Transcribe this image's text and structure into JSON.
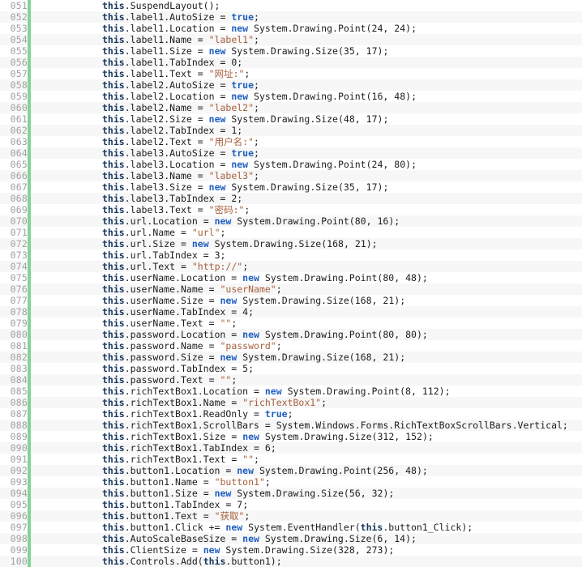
{
  "editor": {
    "name": "code-editor",
    "language": "csharp",
    "first_line_number": 51,
    "last_line_number": 100,
    "colors": {
      "background": "#ffffff",
      "stripe": "#f7f7f7",
      "gutter_text": "#a0a0a0",
      "change_bar": "#7fd695",
      "keyword": "#1f5fbf",
      "this_keyword": "#17365d",
      "string": "#a6603d",
      "plain": "#1c1c1c"
    },
    "indent": "            "
  },
  "lines": [
    {
      "num": "051",
      "text": "this.SuspendLayout();"
    },
    {
      "num": "052",
      "text": "this.label1.AutoSize = true;"
    },
    {
      "num": "053",
      "text": "this.label1.Location = new System.Drawing.Point(24, 24);"
    },
    {
      "num": "054",
      "text": "this.label1.Name = \"label1\";"
    },
    {
      "num": "055",
      "text": "this.label1.Size = new System.Drawing.Size(35, 17);"
    },
    {
      "num": "056",
      "text": "this.label1.TabIndex = 0;"
    },
    {
      "num": "057",
      "text": "this.label1.Text = \"网址:\";"
    },
    {
      "num": "058",
      "text": "this.label2.AutoSize = true;"
    },
    {
      "num": "059",
      "text": "this.label2.Location = new System.Drawing.Point(16, 48);"
    },
    {
      "num": "060",
      "text": "this.label2.Name = \"label2\";"
    },
    {
      "num": "061",
      "text": "this.label2.Size = new System.Drawing.Size(48, 17);"
    },
    {
      "num": "062",
      "text": "this.label2.TabIndex = 1;"
    },
    {
      "num": "063",
      "text": "this.label2.Text = \"用户名:\";"
    },
    {
      "num": "064",
      "text": "this.label3.AutoSize = true;"
    },
    {
      "num": "065",
      "text": "this.label3.Location = new System.Drawing.Point(24, 80);"
    },
    {
      "num": "066",
      "text": "this.label3.Name = \"label3\";"
    },
    {
      "num": "067",
      "text": "this.label3.Size = new System.Drawing.Size(35, 17);"
    },
    {
      "num": "068",
      "text": "this.label3.TabIndex = 2;"
    },
    {
      "num": "069",
      "text": "this.label3.Text = \"密码:\";"
    },
    {
      "num": "070",
      "text": "this.url.Location = new System.Drawing.Point(80, 16);"
    },
    {
      "num": "071",
      "text": "this.url.Name = \"url\";"
    },
    {
      "num": "072",
      "text": "this.url.Size = new System.Drawing.Size(168, 21);"
    },
    {
      "num": "073",
      "text": "this.url.TabIndex = 3;"
    },
    {
      "num": "074",
      "text": "this.url.Text = \"http://\";"
    },
    {
      "num": "075",
      "text": "this.userName.Location = new System.Drawing.Point(80, 48);"
    },
    {
      "num": "076",
      "text": "this.userName.Name = \"userName\";"
    },
    {
      "num": "077",
      "text": "this.userName.Size = new System.Drawing.Size(168, 21);"
    },
    {
      "num": "078",
      "text": "this.userName.TabIndex = 4;"
    },
    {
      "num": "079",
      "text": "this.userName.Text = \"\";"
    },
    {
      "num": "080",
      "text": "this.password.Location = new System.Drawing.Point(80, 80);"
    },
    {
      "num": "081",
      "text": "this.password.Name = \"password\";"
    },
    {
      "num": "082",
      "text": "this.password.Size = new System.Drawing.Size(168, 21);"
    },
    {
      "num": "083",
      "text": "this.password.TabIndex = 5;"
    },
    {
      "num": "084",
      "text": "this.password.Text = \"\";"
    },
    {
      "num": "085",
      "text": "this.richTextBox1.Location = new System.Drawing.Point(8, 112);"
    },
    {
      "num": "086",
      "text": "this.richTextBox1.Name = \"richTextBox1\";"
    },
    {
      "num": "087",
      "text": "this.richTextBox1.ReadOnly = true;"
    },
    {
      "num": "088",
      "text": "this.richTextBox1.ScrollBars = System.Windows.Forms.RichTextBoxScrollBars.Vertical;"
    },
    {
      "num": "089",
      "text": "this.richTextBox1.Size = new System.Drawing.Size(312, 152);"
    },
    {
      "num": "090",
      "text": "this.richTextBox1.TabIndex = 6;"
    },
    {
      "num": "091",
      "text": "this.richTextBox1.Text = \"\";"
    },
    {
      "num": "092",
      "text": "this.button1.Location = new System.Drawing.Point(256, 48);"
    },
    {
      "num": "093",
      "text": "this.button1.Name = \"button1\";"
    },
    {
      "num": "094",
      "text": "this.button1.Size = new System.Drawing.Size(56, 32);"
    },
    {
      "num": "095",
      "text": "this.button1.TabIndex = 7;"
    },
    {
      "num": "096",
      "text": "this.button1.Text = \"获取\";"
    },
    {
      "num": "097",
      "text": "this.button1.Click += new System.EventHandler(this.button1_Click);"
    },
    {
      "num": "098",
      "text": "this.AutoScaleBaseSize = new System.Drawing.Size(6, 14);"
    },
    {
      "num": "099",
      "text": "this.ClientSize = new System.Drawing.Size(328, 273);"
    },
    {
      "num": "100",
      "text": "this.Controls.Add(this.button1);"
    }
  ]
}
